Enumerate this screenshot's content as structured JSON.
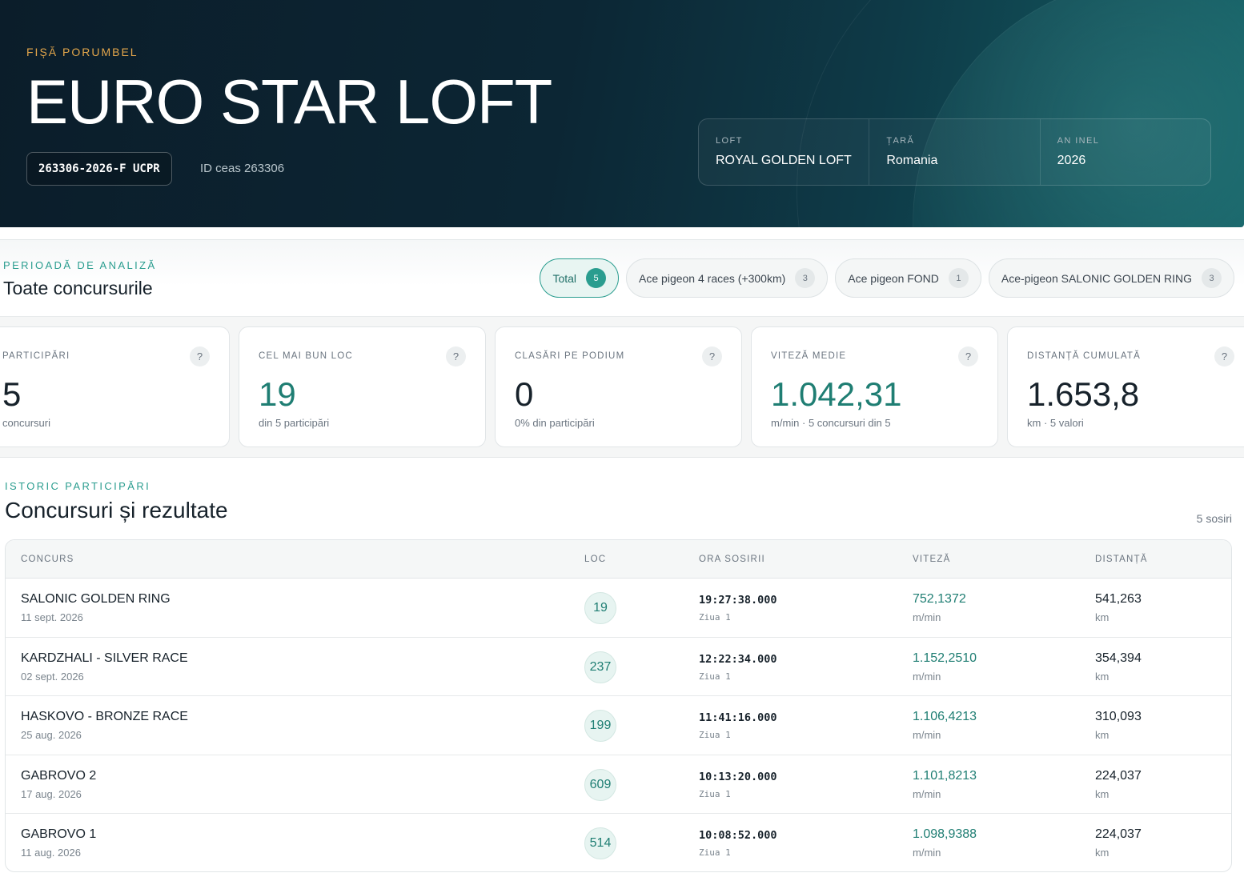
{
  "hero": {
    "eyebrow": "FIȘĂ PORUMBEL",
    "title": "EURO STAR LOFT",
    "ring": "263306-2026-F UCPR",
    "clock_id": "ID ceas 263306",
    "info": [
      {
        "label": "LOFT",
        "value": "ROYAL GOLDEN LOFT"
      },
      {
        "label": "ȚARĂ",
        "value": "Romania"
      },
      {
        "label": "AN INEL",
        "value": "2026"
      }
    ]
  },
  "period": {
    "eyebrow": "PERIOADĂ DE ANALIZĂ",
    "heading": "Toate concursurile",
    "chips": [
      {
        "label": "Total",
        "count": "5"
      },
      {
        "label": "Ace pigeon 4 races (+300km)",
        "count": "3"
      },
      {
        "label": "Ace pigeon FOND",
        "count": "1"
      },
      {
        "label": "Ace-pigeon SALONIC GOLDEN RING",
        "count": "3"
      }
    ]
  },
  "stats": [
    {
      "label": "PARTICIPĂRI",
      "value": "5",
      "sub": "concursuri",
      "help": "?"
    },
    {
      "label": "CEL MAI BUN LOC",
      "value": "19",
      "sub": "din 5 participări",
      "help": "?"
    },
    {
      "label": "CLASĂRI PE PODIUM",
      "value": "0",
      "sub": "0% din participări",
      "help": "?"
    },
    {
      "label": "VITEZĂ MEDIE",
      "value": "1.042,31",
      "sub": "m/min · 5 concursuri din 5",
      "help": "?"
    },
    {
      "label": "DISTANȚĂ CUMULATĂ",
      "value": "1.653,8",
      "sub": "km · 5 valori",
      "help": "?"
    }
  ],
  "history": {
    "eyebrow": "ISTORIC PARTICIPĂRI",
    "title": "Concursuri și rezultate",
    "count": "5 sosiri",
    "columns": [
      "CONCURS",
      "LOC",
      "ORA SOSIRII",
      "VITEZĂ",
      "DISTANȚĂ"
    ],
    "rows": [
      {
        "name": "SALONIC GOLDEN RING",
        "date": "11 sept. 2026",
        "loc": "19",
        "time": "19:27:38.000",
        "day": "Ziua 1",
        "speed": "752,1372",
        "speed_unit": "m/min",
        "dist": "541,263",
        "dist_unit": "km"
      },
      {
        "name": "KARDZHALI - SILVER RACE",
        "date": "02 sept. 2026",
        "loc": "237",
        "time": "12:22:34.000",
        "day": "Ziua 1",
        "speed": "1.152,2510",
        "speed_unit": "m/min",
        "dist": "354,394",
        "dist_unit": "km"
      },
      {
        "name": "HASKOVO - BRONZE RACE",
        "date": "25 aug. 2026",
        "loc": "199",
        "time": "11:41:16.000",
        "day": "Ziua 1",
        "speed": "1.106,4213",
        "speed_unit": "m/min",
        "dist": "310,093",
        "dist_unit": "km"
      },
      {
        "name": "GABROVO 2",
        "date": "17 aug. 2026",
        "loc": "609",
        "time": "10:13:20.000",
        "day": "Ziua 1",
        "speed": "1.101,8213",
        "speed_unit": "m/min",
        "dist": "224,037",
        "dist_unit": "km"
      },
      {
        "name": "GABROVO 1",
        "date": "11 aug. 2026",
        "loc": "514",
        "time": "10:08:52.000",
        "day": "Ziua 1",
        "speed": "1.098,9388",
        "speed_unit": "m/min",
        "dist": "224,037",
        "dist_unit": "km"
      }
    ]
  }
}
